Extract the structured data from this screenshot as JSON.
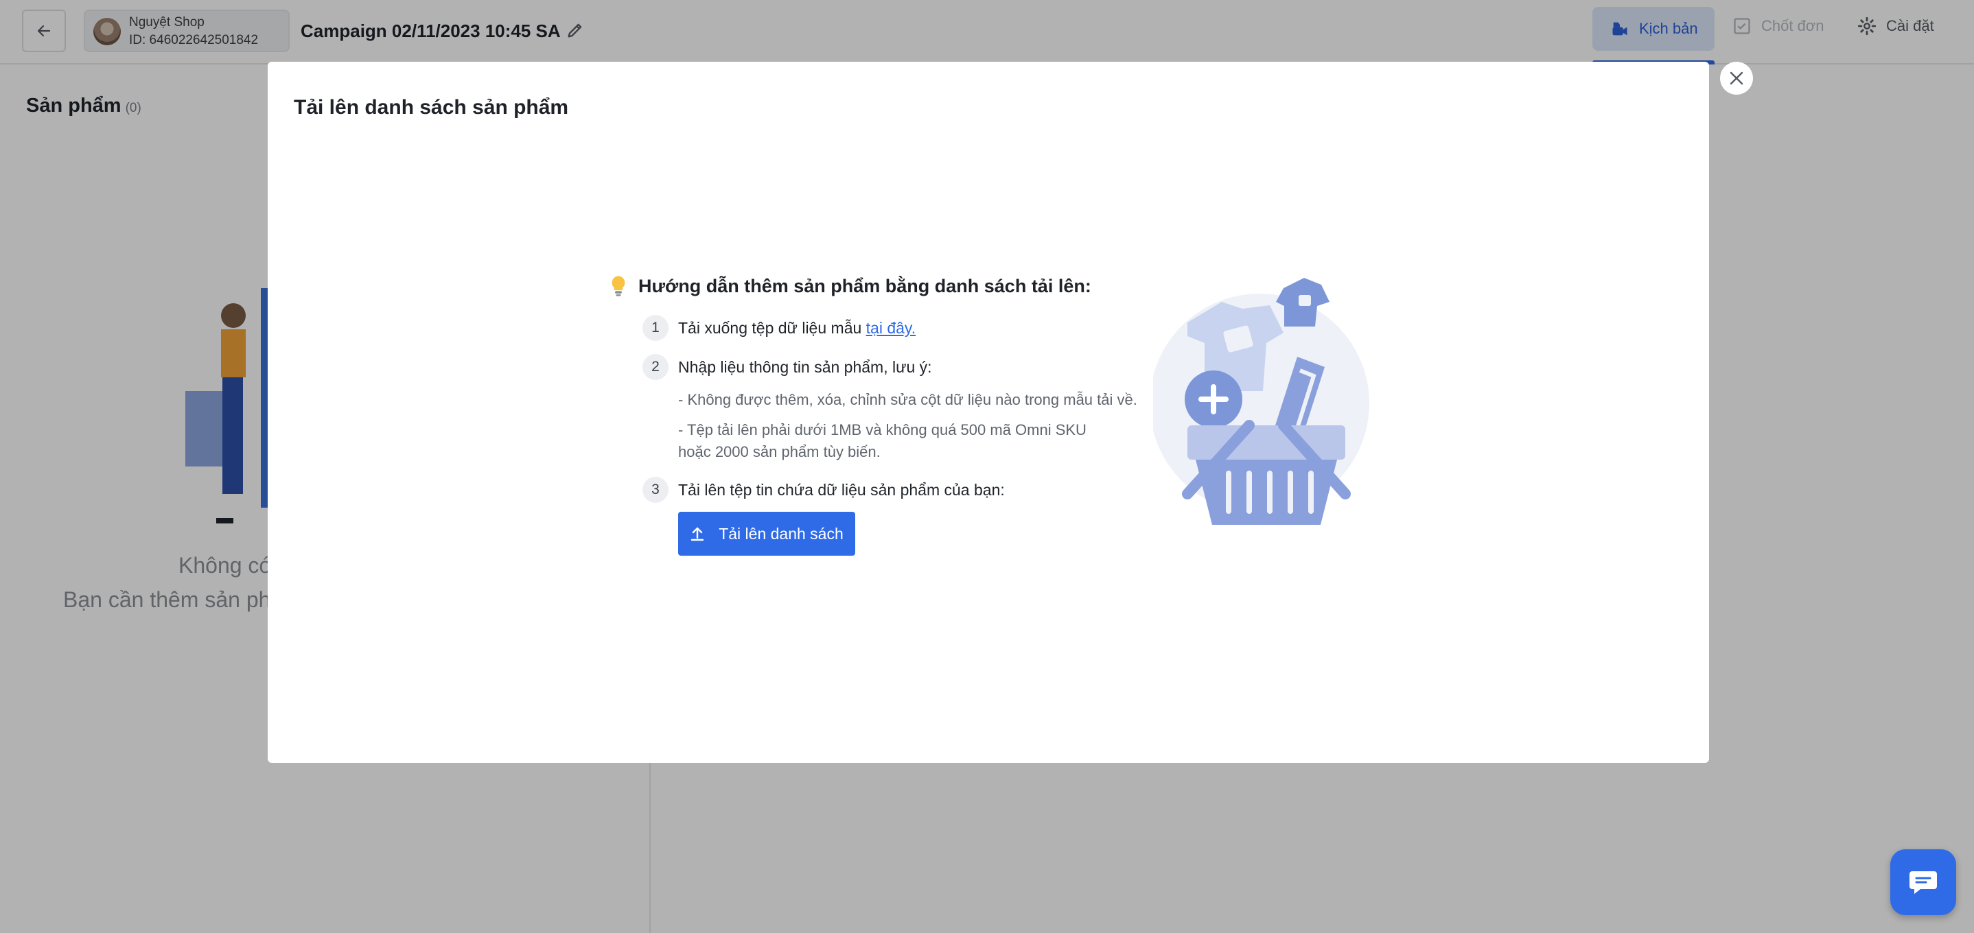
{
  "header": {
    "shop_name": "Nguyệt Shop",
    "shop_id": "ID: 646022642501842",
    "campaign_title": "Campaign 02/11/2023 10:45 SA",
    "tabs": {
      "script": "Kịch bản",
      "close_order": "Chốt đơn",
      "settings": "Cài đặt"
    }
  },
  "page": {
    "products_title": "Sản phẩm",
    "products_count": "(0)",
    "empty_line_1": "Không có",
    "empty_line_2": "Bạn cần thêm sản phẩ"
  },
  "modal": {
    "title": "Tải lên danh sách sản phẩm",
    "guide_title": "Hướng dẫn thêm sản phẩm bằng danh sách tải lên:",
    "steps": [
      {
        "num": "1",
        "text": "Tải xuống tệp dữ liệu mẫu ",
        "link": "tại đây."
      },
      {
        "num": "2",
        "text": "Nhập liệu thông tin sản phẩm, lưu ý:"
      },
      {
        "num": "3",
        "text": "Tải lên tệp tin chứa dữ liệu sản phẩm của bạn:"
      }
    ],
    "notes": [
      "- Không được thêm, xóa, chỉnh sửa cột dữ liệu nào trong mẫu tải về.",
      "- Tệp tải lên phải dưới 1MB và không quá 500 mã Omni SKU",
      "hoặc 2000 sản phẩm tùy biến."
    ],
    "upload_button": "Tải lên danh sách"
  },
  "icons": {
    "back": "arrow-left-icon",
    "edit": "pencil-icon",
    "script": "camera-icon",
    "close_order": "checklist-icon",
    "settings": "gear-icon",
    "modal_close": "close-icon",
    "guide": "lightbulb-icon",
    "upload": "upload-icon",
    "chat": "chat-icon"
  },
  "colors": {
    "primary": "#2f6be6",
    "tab_active_bg": "#dfe9fb",
    "overlay": "rgba(0,0,0,0.30)"
  }
}
